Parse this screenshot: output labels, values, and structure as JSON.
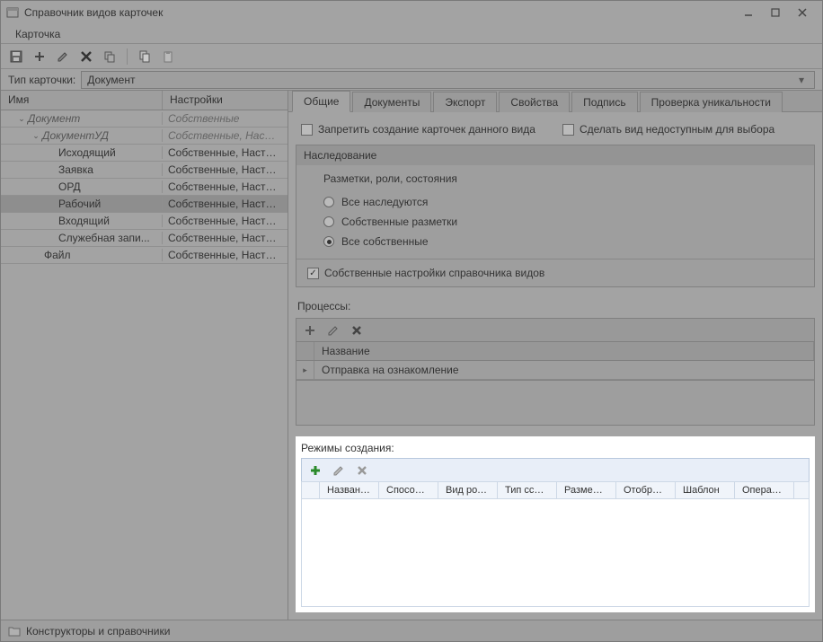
{
  "window": {
    "title": "Справочник видов карточек"
  },
  "menu": {
    "card": "Карточка"
  },
  "filter": {
    "label": "Тип карточки:",
    "value": "Документ"
  },
  "tree": {
    "headers": {
      "name": "Имя",
      "settings": "Настройки"
    },
    "rows": [
      {
        "indent": 1,
        "expand": "down",
        "label": "Документ",
        "italic": true,
        "settings": "Собственные",
        "settingsItalic": true
      },
      {
        "indent": 2,
        "expand": "down",
        "label": "ДокументУД",
        "italic": true,
        "settings": "Собственные, Наст...",
        "settingsItalic": true
      },
      {
        "indent": 4,
        "label": "Исходящий",
        "settings": "Собственные, Настро..."
      },
      {
        "indent": 4,
        "label": "Заявка",
        "settings": "Собственные, Настро..."
      },
      {
        "indent": 4,
        "label": "ОРД",
        "settings": "Собственные, Настро..."
      },
      {
        "indent": 4,
        "label": "Рабочий",
        "settings": "Собственные, Настро...",
        "selected": true
      },
      {
        "indent": 4,
        "label": "Входящий",
        "settings": "Собственные, Настро..."
      },
      {
        "indent": 4,
        "label": "Служебная запи...",
        "settings": "Собственные, Настро..."
      },
      {
        "indent": 3,
        "label": "Файл",
        "settings": "Собственные, Настро..."
      }
    ]
  },
  "tabs": [
    {
      "label": "Общие",
      "active": true
    },
    {
      "label": "Документы"
    },
    {
      "label": "Экспорт"
    },
    {
      "label": "Свойства"
    },
    {
      "label": "Подпись"
    },
    {
      "label": "Проверка уникальности"
    }
  ],
  "general": {
    "forbidCreate": "Запретить создание карточек данного вида",
    "makeUnavailable": "Сделать вид недоступным для выбора",
    "inheritance": {
      "title": "Наследование",
      "subtitle": "Разметки, роли, состояния",
      "options": [
        {
          "label": "Все наследуются",
          "checked": false
        },
        {
          "label": "Собственные разметки",
          "checked": false
        },
        {
          "label": "Все собственные",
          "checked": true
        }
      ],
      "ownSettings": "Собственные настройки справочника видов"
    },
    "processes": {
      "title": "Процессы:",
      "header": "Название",
      "row": "Отправка на ознакомление"
    },
    "modes": {
      "title": "Режимы создания:",
      "headers": [
        "Название",
        "Способ со...",
        "Вид роди...",
        "Тип ссылки",
        "Размещен...",
        "Отображ...",
        "Шаблон",
        "Операция..."
      ]
    }
  },
  "statusbar": {
    "text": "Конструкторы и справочники"
  }
}
